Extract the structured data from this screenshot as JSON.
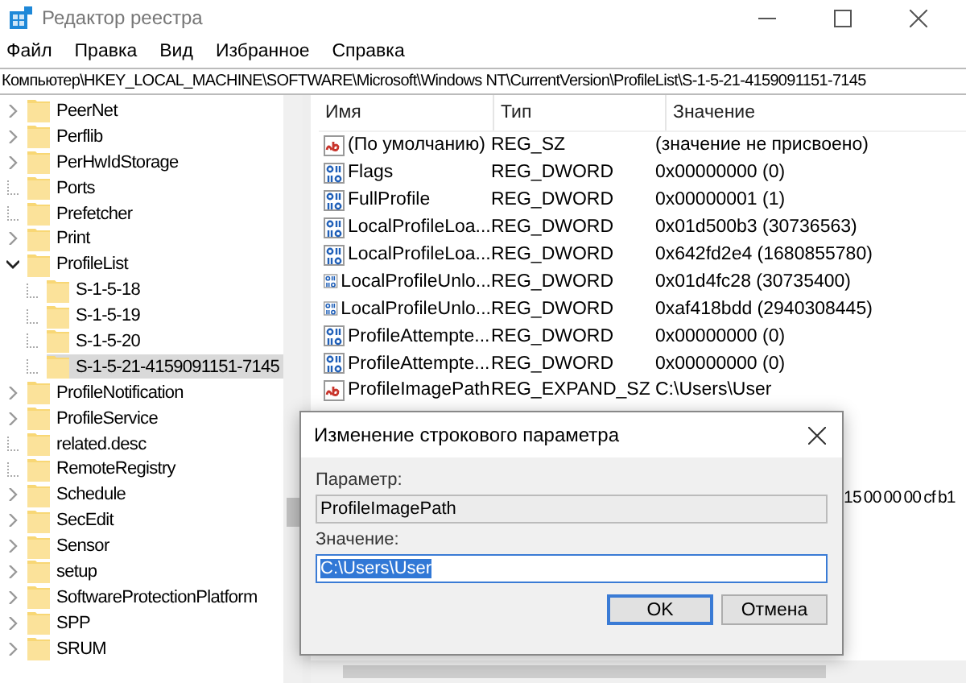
{
  "window": {
    "title": "Редактор реестра"
  },
  "menu": [
    "Файл",
    "Правка",
    "Вид",
    "Избранное",
    "Справка"
  ],
  "address": "Компьютер\\HKEY_LOCAL_MACHINE\\SOFTWARE\\Microsoft\\Windows NT\\CurrentVersion\\ProfileList\\S-1-5-21-4159091151-7145",
  "tree": [
    {
      "label": "PeerNet",
      "has_children": true,
      "expanded": false,
      "selected": false
    },
    {
      "label": "Perflib",
      "has_children": true,
      "expanded": false,
      "selected": false
    },
    {
      "label": "PerHwIdStorage",
      "has_children": true,
      "expanded": false,
      "selected": false
    },
    {
      "label": "Ports",
      "has_children": false,
      "selected": false
    },
    {
      "label": "Prefetcher",
      "has_children": false,
      "selected": false
    },
    {
      "label": "Print",
      "has_children": true,
      "expanded": false,
      "selected": false
    },
    {
      "label": "ProfileList",
      "has_children": true,
      "expanded": true,
      "selected": false,
      "children": [
        {
          "label": "S-1-5-18",
          "has_children": false,
          "selected": false
        },
        {
          "label": "S-1-5-19",
          "has_children": false,
          "selected": false
        },
        {
          "label": "S-1-5-20",
          "has_children": false,
          "selected": false
        },
        {
          "label": "S-1-5-21-4159091151-7145",
          "has_children": false,
          "selected": true
        }
      ]
    },
    {
      "label": "ProfileNotification",
      "has_children": true,
      "expanded": false,
      "selected": false
    },
    {
      "label": "ProfileService",
      "has_children": true,
      "expanded": false,
      "selected": false
    },
    {
      "label": "related.desc",
      "has_children": false,
      "selected": false
    },
    {
      "label": "RemoteRegistry",
      "has_children": false,
      "selected": false
    },
    {
      "label": "Schedule",
      "has_children": true,
      "expanded": false,
      "selected": false
    },
    {
      "label": "SecEdit",
      "has_children": true,
      "expanded": false,
      "selected": false
    },
    {
      "label": "Sensor",
      "has_children": true,
      "expanded": false,
      "selected": false
    },
    {
      "label": "setup",
      "has_children": true,
      "expanded": false,
      "selected": false
    },
    {
      "label": "SoftwareProtectionPlatform",
      "has_children": true,
      "expanded": false,
      "selected": false
    },
    {
      "label": "SPP",
      "has_children": true,
      "expanded": false,
      "selected": false
    },
    {
      "label": "SRUM",
      "has_children": true,
      "expanded": false,
      "selected": false
    }
  ],
  "values": {
    "columns": [
      "Имя",
      "Тип",
      "Значение"
    ],
    "rows": [
      {
        "kind": "string",
        "name": "(По умолчанию)",
        "type": "REG_SZ",
        "value": "(значение не присвоено)"
      },
      {
        "kind": "binary",
        "name": "Flags",
        "type": "REG_DWORD",
        "value": "0x00000000 (0)"
      },
      {
        "kind": "binary",
        "name": "FullProfile",
        "type": "REG_DWORD",
        "value": "0x00000001 (1)"
      },
      {
        "kind": "binary",
        "name": "LocalProfileLoa...",
        "type": "REG_DWORD",
        "value": "0x01d500b3 (30736563)"
      },
      {
        "kind": "binary",
        "name": "LocalProfileLoa...",
        "type": "REG_DWORD",
        "value": "0x642fd2e4 (1680855780)"
      },
      {
        "kind": "binary",
        "name": "LocalProfileUnlo...",
        "type": "REG_DWORD",
        "value": "0x01d4fc28 (30735400)"
      },
      {
        "kind": "binary",
        "name": "LocalProfileUnlo...",
        "type": "REG_DWORD",
        "value": "0xaf418bdd (2940308445)"
      },
      {
        "kind": "binary",
        "name": "ProfileAttempte...",
        "type": "REG_DWORD",
        "value": "0x00000000 (0)"
      },
      {
        "kind": "binary",
        "name": "ProfileAttempte...",
        "type": "REG_DWORD",
        "value": "0x00000000 (0)"
      },
      {
        "kind": "string",
        "name": "ProfileImagePath",
        "type": "REG_EXPAND_SZ",
        "value": "C:\\Users\\User"
      }
    ],
    "obscured_value": "15 00 00 00 cf b1"
  },
  "dialog": {
    "title": "Изменение строкового параметра",
    "name_label": "Параметр:",
    "name_value": "ProfileImagePath",
    "value_label": "Значение:",
    "value": "C:\\Users\\User",
    "buttons": [
      "OK",
      "Отмена"
    ]
  }
}
